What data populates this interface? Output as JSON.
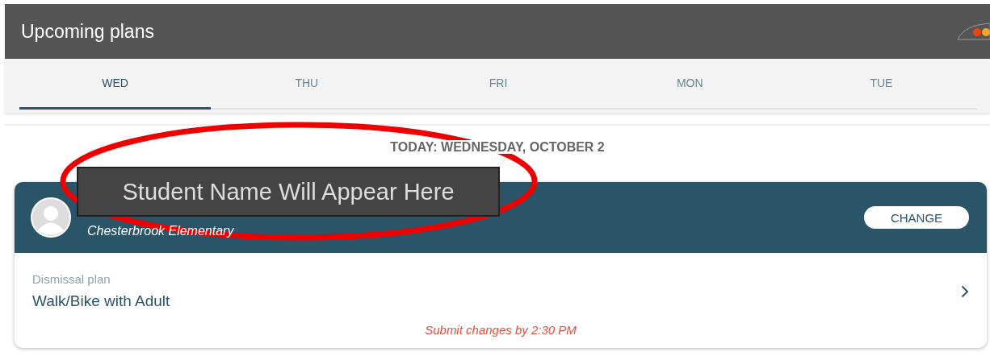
{
  "header": {
    "title": "Upcoming plans"
  },
  "tabs": [
    {
      "label": "WED",
      "selected": true
    },
    {
      "label": "THU",
      "selected": false
    },
    {
      "label": "FRI",
      "selected": false
    },
    {
      "label": "MON",
      "selected": false
    },
    {
      "label": "TUE",
      "selected": false
    }
  ],
  "date_heading": "TODAY: WEDNESDAY, OCTOBER 2",
  "student_card": {
    "school": "Chesterbrook Elementary",
    "change_button": "CHANGE",
    "plan_label": "Dismissal plan",
    "plan_value": "Walk/Bike with Adult",
    "deadline": "Submit changes by 2:30 PM"
  },
  "annotation": {
    "label": "Student Name Will Appear Here"
  }
}
